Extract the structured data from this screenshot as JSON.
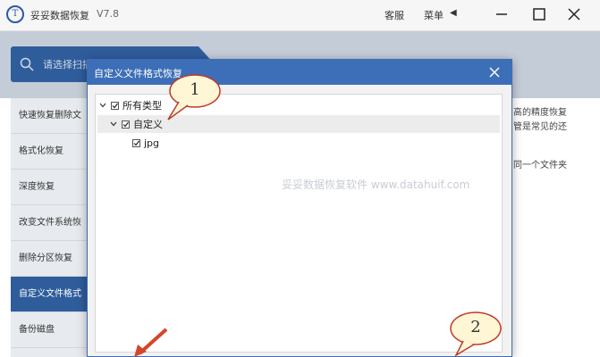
{
  "app": {
    "title": "妥妥数据恢复",
    "version": "V7.8",
    "support_label": "客服",
    "menu_label": "菜单"
  },
  "search": {
    "placeholder": "请选择扫描"
  },
  "sidebar": {
    "items": [
      {
        "label": "快速恢复删除文"
      },
      {
        "label": "格式化恢复"
      },
      {
        "label": "深度恢复"
      },
      {
        "label": "改变文件系统恢"
      },
      {
        "label": "删除分区恢复"
      },
      {
        "label": "自定义文件格式"
      },
      {
        "label": "备份磁盘"
      }
    ],
    "active_index": 5
  },
  "right_panel": {
    "line1": "高的精度恢复",
    "line2": "管是常见的还",
    "line3": "同一个文件夹"
  },
  "watermark": "妥妥数据恢复软件  www.datahuif.com",
  "dialog": {
    "title": "自定义文件格式恢复",
    "tree": [
      {
        "label": "所有类型",
        "level": 0,
        "expanded": true,
        "checked": true
      },
      {
        "label": "自定义",
        "level": 1,
        "expanded": true,
        "checked": true,
        "selected": true
      },
      {
        "label": "jpg",
        "level": 2,
        "checked": true
      }
    ]
  },
  "callouts": [
    {
      "number": "1"
    },
    {
      "number": "2"
    }
  ],
  "colors": {
    "accent": "#2f5d9c",
    "dialog_header": "#3c6fb7",
    "callout_fill": "#fff6d6",
    "callout_stroke": "#c0392b",
    "arrow": "#d4462a"
  }
}
